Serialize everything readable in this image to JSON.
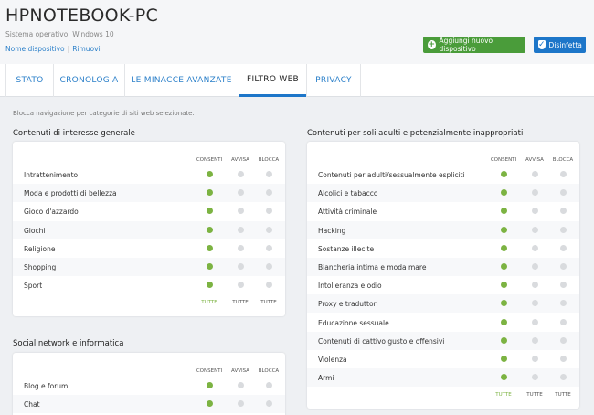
{
  "device": {
    "name": "HPNOTEBOOK-PC",
    "os_label": "Sistema operativo:",
    "os_value": "Windows 10",
    "rename_link": "Nome dispositivo",
    "remove_link": "Rimuovi"
  },
  "buttons": {
    "add_device": "Aggiungi nuovo dispositivo",
    "disinfect": "Disinfetta",
    "accent_green": "#4a9c3a",
    "accent_blue": "#1d76c9"
  },
  "tabs": [
    {
      "label": "STATO"
    },
    {
      "label": "CRONOLOGIA"
    },
    {
      "label": "LE MINACCE AVANZATE"
    },
    {
      "label": "FILTRO WEB"
    },
    {
      "label": "PRIVACY"
    }
  ],
  "active_tab": "FILTRO WEB",
  "subtitle": "Blocca navigazione per categorie di siti web selezionate.",
  "columns": {
    "allow": "CONSENTI",
    "warn": "AVVISA",
    "block": "BLOCCA"
  },
  "footer": {
    "all": "TUTTE"
  },
  "sections": {
    "general": {
      "title": "Contenuti di interesse generale",
      "rows": [
        {
          "label": "Intrattenimento",
          "state": "allow"
        },
        {
          "label": "Moda e prodotti di bellezza",
          "state": "allow"
        },
        {
          "label": "Gioco d'azzardo",
          "state": "allow"
        },
        {
          "label": "Giochi",
          "state": "allow"
        },
        {
          "label": "Religione",
          "state": "allow"
        },
        {
          "label": "Shopping",
          "state": "allow"
        },
        {
          "label": "Sport",
          "state": "allow"
        }
      ]
    },
    "social": {
      "title": "Social network e informatica",
      "rows": [
        {
          "label": "Blog e forum",
          "state": "allow"
        },
        {
          "label": "Chat",
          "state": "allow"
        }
      ]
    },
    "adult": {
      "title": "Contenuti per soli adulti e potenzialmente inappropriati",
      "rows": [
        {
          "label": "Contenuti per adulti/sessualmente espliciti",
          "state": "allow"
        },
        {
          "label": "Alcolici e tabacco",
          "state": "allow"
        },
        {
          "label": "Attività criminale",
          "state": "allow"
        },
        {
          "label": "Hacking",
          "state": "allow"
        },
        {
          "label": "Sostanze illecite",
          "state": "allow"
        },
        {
          "label": "Biancheria intima e moda mare",
          "state": "allow"
        },
        {
          "label": "Intolleranza e odio",
          "state": "allow"
        },
        {
          "label": "Proxy e traduttori",
          "state": "allow"
        },
        {
          "label": "Educazione sessuale",
          "state": "allow"
        },
        {
          "label": "Contenuti di cattivo gusto e offensivi",
          "state": "allow"
        },
        {
          "label": "Violenza",
          "state": "allow"
        },
        {
          "label": "Armi",
          "state": "allow"
        }
      ]
    }
  }
}
